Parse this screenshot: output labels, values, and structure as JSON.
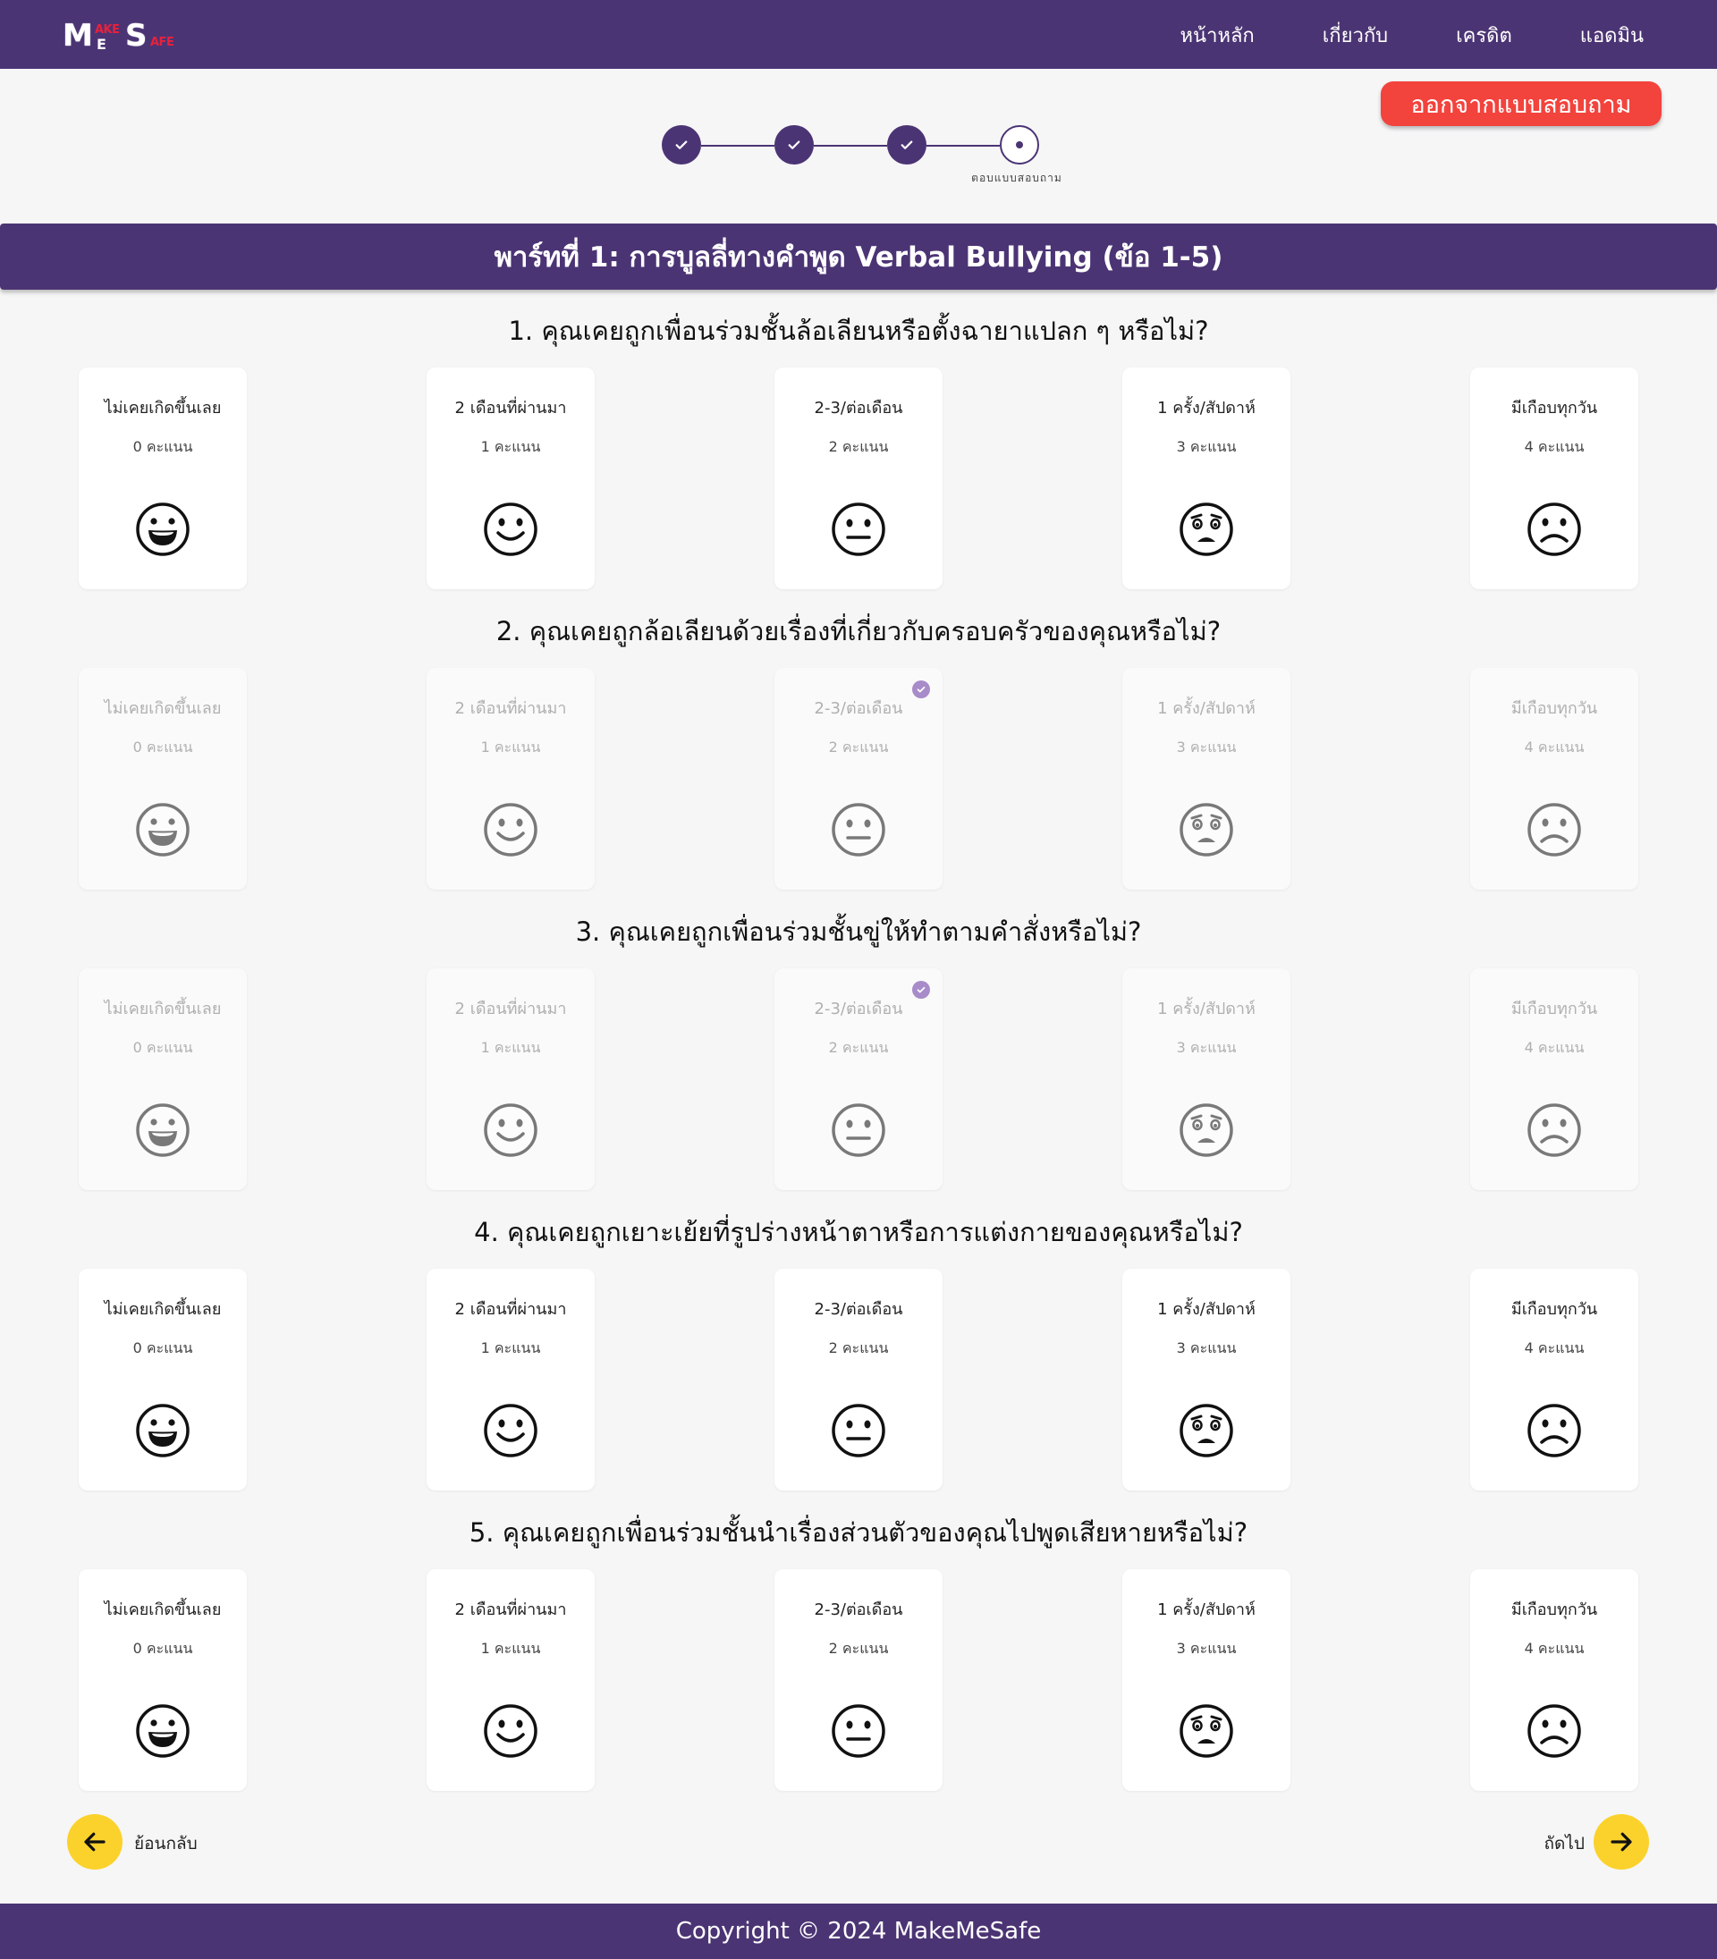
{
  "brand": {
    "m": "M",
    "ake": "AKE",
    "e": "E",
    "s": "S",
    "afe": "AFE"
  },
  "nav": {
    "links": [
      "หน้าหลัก",
      "เกี่ยวกับ",
      "เครดิต",
      "แอดมิน"
    ]
  },
  "exit_button": "ออกจากแบบสอบถาม",
  "stepper": {
    "current_label": "ตอบแบบสอบถาม",
    "completed_steps": 3,
    "total_steps": 4
  },
  "part_title": "พาร์ทที่ 1: การบูลลี่ทางคำพูด Verbal Bullying (ข้อ 1-5)",
  "options": [
    {
      "label": "ไม่เคยเกิดขึ้นเลย",
      "points": "0 คะแนน",
      "icon": "grinning-face-icon"
    },
    {
      "label": "2 เดือนที่ผ่านมา",
      "points": "1 คะแนน",
      "icon": "smiling-face-icon"
    },
    {
      "label": "2-3/ต่อเดือน",
      "points": "2 คะแนน",
      "icon": "neutral-face-icon"
    },
    {
      "label": "1 ครั้ง/สัปดาห์",
      "points": "3 คะแนน",
      "icon": "worried-face-icon"
    },
    {
      "label": "มีเกือบทุกวัน",
      "points": "4 คะแนน",
      "icon": "frowning-face-icon"
    }
  ],
  "questions": [
    {
      "title": "1. คุณเคยถูกเพื่อนร่วมชั้นล้อเลียนหรือตั้งฉายาแปลก ๆ หรือไม่?",
      "answered": false,
      "selected": null
    },
    {
      "title": "2. คุณเคยถูกล้อเลียนด้วยเรื่องที่เกี่ยวกับครอบครัวของคุณหรือไม่?",
      "answered": true,
      "selected": 2
    },
    {
      "title": "3. คุณเคยถูกเพื่อนร่วมชั้นขู่ให้ทำตามคำสั่งหรือไม่?",
      "answered": true,
      "selected": 2
    },
    {
      "title": "4. คุณเคยถูกเยาะเย้ยที่รูปร่างหน้าตาหรือการแต่งกายของคุณหรือไม่?",
      "answered": false,
      "selected": null
    },
    {
      "title": "5. คุณเคยถูกเพื่อนร่วมชั้นนำเรื่องส่วนตัวของคุณไปพูดเสียหายหรือไม่?",
      "answered": false,
      "selected": null
    }
  ],
  "back_label": "ย้อนกลับ",
  "next_label": "ถัดไป",
  "footer": "Copyright © 2024 MakeMeSafe",
  "colors": {
    "primary": "#4b3474",
    "exit": "#f2433d",
    "nav_button": "#fbd22c",
    "selected_badge": "#a88bc9",
    "background": "#f6f6f7"
  }
}
